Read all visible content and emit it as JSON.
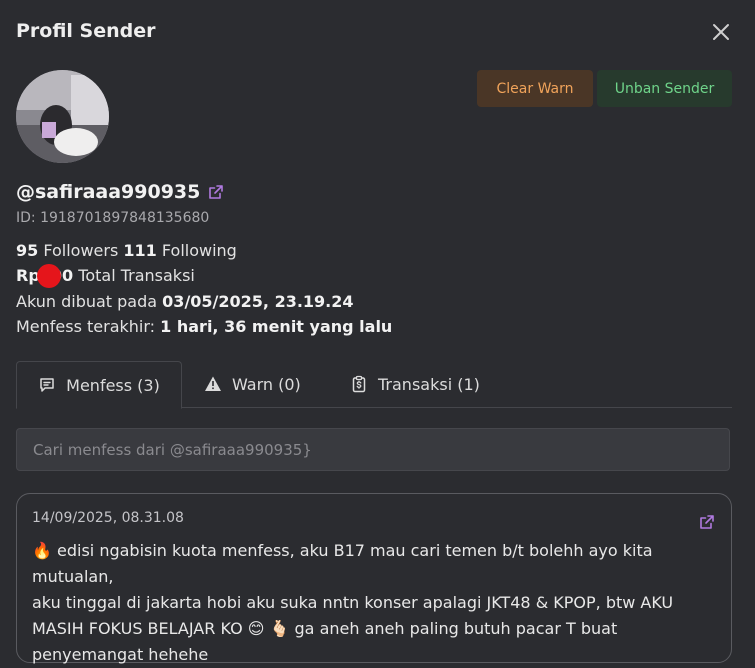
{
  "modal": {
    "title": "Profil Sender",
    "clear_warn_label": "Clear Warn",
    "unban_label": "Unban Sender"
  },
  "profile": {
    "username": "@safiraaa990935",
    "id_text": "ID: 1918701897848135680",
    "followers_count": "95",
    "followers_label": "Followers",
    "following_count": "111",
    "following_label": "Following",
    "transaksi_amount": "Rp000",
    "transaksi_label": "Total Transaksi",
    "created_label": "Akun dibuat pada",
    "created_value": "03/05/2025, 23.19.24",
    "last_menfess_label": "Menfess terakhir:",
    "last_menfess_value": "1 hari, 36 menit yang lalu"
  },
  "tabs": [
    {
      "label": "Menfess (3)",
      "icon": "message-icon",
      "active": true
    },
    {
      "label": "Warn (0)",
      "icon": "warning-icon",
      "active": false
    },
    {
      "label": "Transaksi (1)",
      "icon": "clipboard-dollar-icon",
      "active": false
    }
  ],
  "search": {
    "placeholder": "Cari menfess dari @safiraaa990935}"
  },
  "menfess": [
    {
      "date": "14/09/2025, 08.31.08",
      "text_lines": [
        "🔥 edisi ngabisin kuota menfess, aku B17 mau cari temen b/t bolehh ayo kita mutualan,",
        "aku tinggal di jakarta hobi aku suka nntn konser apalagi JKT48 & KPOP, btw AKU",
        "MASIH FOKUS BELAJAR KO 😊 🫰🏻 ga aneh aneh paling butuh pacar T buat",
        "penyemangat hehehe"
      ]
    }
  ],
  "colors": {
    "background": "#2b2c30",
    "clear_warn_bg": "#4a3626",
    "clear_warn_text": "#f0a35a",
    "unban_bg": "#273a2d",
    "unban_text": "#6fd48a",
    "redaction_dot": "#e5151b"
  }
}
